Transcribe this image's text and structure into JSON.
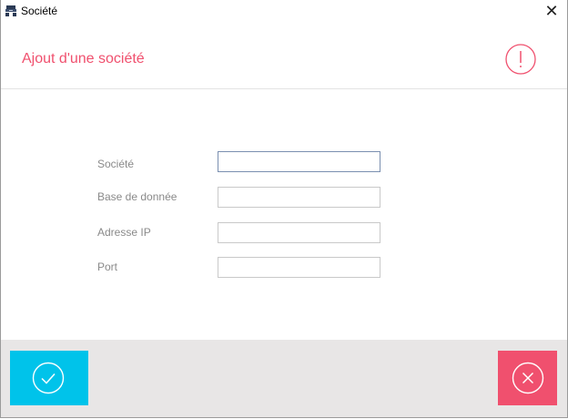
{
  "window": {
    "title": "Société"
  },
  "header": {
    "title": "Ajout d'une société"
  },
  "form": {
    "fields": [
      {
        "label": "Société",
        "value": ""
      },
      {
        "label": "Base de donnée",
        "value": ""
      },
      {
        "label": "Adresse IP",
        "value": ""
      },
      {
        "label": "Port",
        "value": ""
      }
    ]
  },
  "icons": {
    "app": "database-icon",
    "close": "close-icon",
    "alert": "alert-icon",
    "confirm": "check-icon",
    "cancel": "cancel-icon"
  },
  "colors": {
    "accent": "#f0506e",
    "confirm": "#00c3ea",
    "cancel": "#f0506e",
    "footer": "#e8e6e6"
  }
}
